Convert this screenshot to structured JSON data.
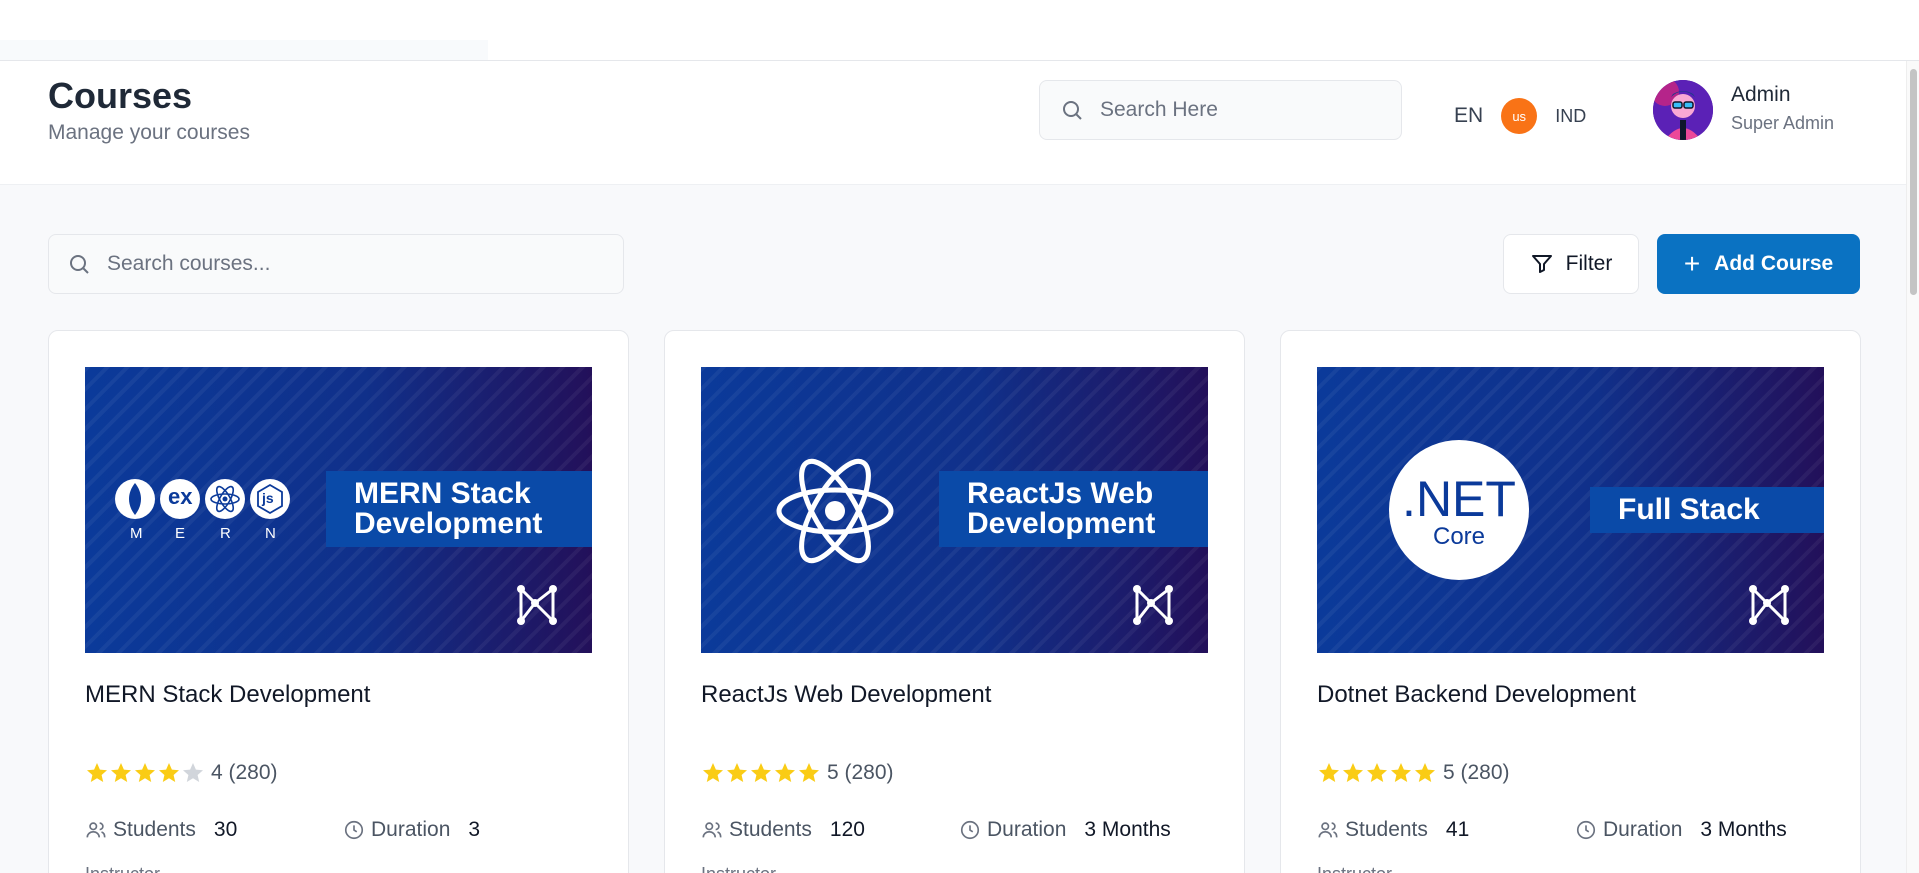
{
  "header": {
    "title": "Courses",
    "subtitle": "Manage your courses",
    "search_placeholder": "Search Here",
    "lang_code": "EN",
    "lang_badge": "us",
    "region": "IND",
    "user_name": "Admin",
    "user_role": "Super Admin"
  },
  "toolbar": {
    "search_placeholder": "Search courses...",
    "filter_label": "Filter",
    "add_label": "Add Course"
  },
  "labels": {
    "students": "Students",
    "duration": "Duration",
    "instructor": "Instructor"
  },
  "colors": {
    "primary": "#0a72c2",
    "star": "#facc15",
    "star_empty": "#d1d5db",
    "badge": "#f97316"
  },
  "courses": [
    {
      "title": "MERN Stack Development",
      "banner_line1": "MERN Stack",
      "banner_line2": "Development",
      "logo_letters": [
        "M",
        "E",
        "R",
        "N"
      ],
      "logo_ex": "ex",
      "logo_js": "js",
      "rating_text": "4 (280)",
      "rating_value": 4,
      "students": "30",
      "duration": "3"
    },
    {
      "title": "ReactJs Web Development",
      "banner_line1": "ReactJs Web",
      "banner_line2": "Development",
      "rating_text": "5 (280)",
      "rating_value": 5,
      "students": "120",
      "duration": "3 Months"
    },
    {
      "title": "Dotnet Backend Development",
      "banner_line1": "Full Stack",
      "dotnet_text": ".NET",
      "dotnet_sub": "Core",
      "rating_text": "5 (280)",
      "rating_value": 5,
      "students": "41",
      "duration": "3 Months"
    }
  ]
}
